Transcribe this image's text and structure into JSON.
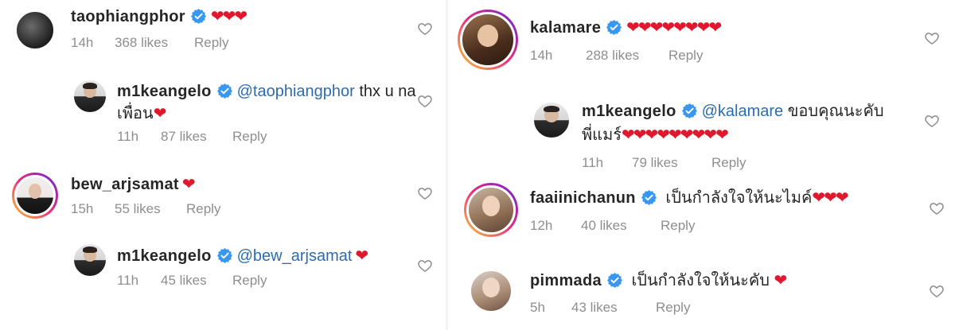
{
  "colors": {
    "heart": "#e0182d",
    "verified": "#3897f0",
    "mention": "#2b6cb0",
    "meta": "#8e8e8e"
  },
  "left": {
    "c1": {
      "username": "taophiangphor",
      "text": "",
      "hearts": "❤❤❤",
      "time": "14h",
      "likes": "368 likes",
      "reply": "Reply"
    },
    "c2": {
      "username": "m1keangelo",
      "mention": "@taophiangphor",
      "text": " thx u na",
      "text2": "เพื่อน",
      "hearts": "❤",
      "time": "11h",
      "likes": "87 likes",
      "reply": "Reply"
    },
    "c3": {
      "username": "bew_arjsamat",
      "hearts": "❤",
      "time": "15h",
      "likes": "55 likes",
      "reply": "Reply"
    },
    "c4": {
      "username": "m1keangelo",
      "mention": "@bew_arjsamat",
      "hearts": "❤",
      "time": "11h",
      "likes": "45 likes",
      "reply": "Reply"
    }
  },
  "right": {
    "c1": {
      "username": "kalamare",
      "hearts": "❤❤❤❤❤❤❤❤",
      "time": "14h",
      "likes": "288 likes",
      "reply": "Reply"
    },
    "c2": {
      "username": "m1keangelo",
      "mention": "@kalamare",
      "text": " ขอบคุณนะคับ",
      "text2": "พี่แมร์",
      "hearts": "❤❤❤❤❤❤❤❤❤",
      "time": "11h",
      "likes": "79 likes",
      "reply": "Reply"
    },
    "c3": {
      "username": "faaiinichanun",
      "text": " เป็นกำลังใจให้นะไมค์",
      "hearts": "❤❤❤",
      "time": "12h",
      "likes": "40 likes",
      "reply": "Reply"
    },
    "c4": {
      "username": "pimmada",
      "text": " เป็นกำลังใจให้นะคับ ",
      "hearts": "❤",
      "time": "5h",
      "likes": "43 likes",
      "reply": "Reply"
    }
  }
}
